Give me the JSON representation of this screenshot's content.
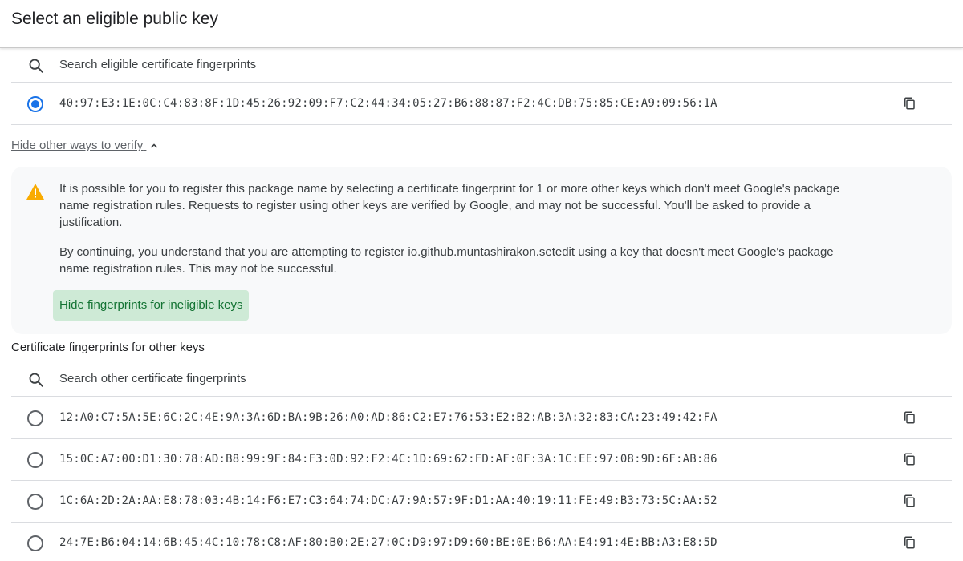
{
  "header": {
    "title": "Select an eligible public key"
  },
  "eligible": {
    "search_placeholder": "Search eligible certificate fingerprints",
    "fingerprints": [
      {
        "value": "40:97:E3:1E:0C:C4:83:8F:1D:45:26:92:09:F7:C2:44:34:05:27:B6:88:87:F2:4C:DB:75:85:CE:A9:09:56:1A",
        "selected": true
      }
    ]
  },
  "toggle": {
    "label": "Hide other ways to verify",
    "icon": "chevron-up-icon"
  },
  "warning": {
    "icon": "warning-icon",
    "paragraph1": "It is possible for you to register this package name by selecting a certificate fingerprint for 1 or more other keys which don't meet Google's package name registration rules. Requests to register using other keys are verified by Google, and may not be successful. You'll be asked to provide a justification.",
    "paragraph2": "By continuing, you understand that you are attempting to register io.github.muntashirakon.setedit using a key that doesn't meet Google's package name registration rules. This may not be successful.",
    "button_label": "Hide fingerprints for ineligible keys"
  },
  "other": {
    "title": "Certificate fingerprints for other keys",
    "search_placeholder": "Search other certificate fingerprints",
    "fingerprints": [
      {
        "value": "12:A0:C7:5A:5E:6C:2C:4E:9A:3A:6D:BA:9B:26:A0:AD:86:C2:E7:76:53:E2:B2:AB:3A:32:83:CA:23:49:42:FA",
        "selected": false
      },
      {
        "value": "15:0C:A7:00:D1:30:78:AD:B8:99:9F:84:F3:0D:92:F2:4C:1D:69:62:FD:AF:0F:3A:1C:EE:97:08:9D:6F:AB:86",
        "selected": false
      },
      {
        "value": "1C:6A:2D:2A:AA:E8:78:03:4B:14:F6:E7:C3:64:74:DC:A7:9A:57:9F:D1:AA:40:19:11:FE:49:B3:73:5C:AA:52",
        "selected": false
      },
      {
        "value": "24:7E:B6:04:14:6B:45:4C:10:78:C8:AF:80:B0:2E:27:0C:D9:97:D9:60:BE:0E:B6:AA:E4:91:4E:BB:A3:E8:5D",
        "selected": false
      }
    ]
  },
  "colors": {
    "accent": "#1a73e8",
    "success_bg": "#ceead6",
    "success_text": "#137333",
    "warning": "#f9ab00"
  }
}
